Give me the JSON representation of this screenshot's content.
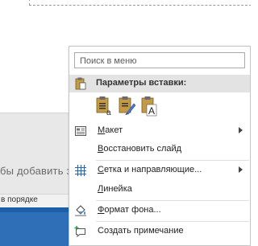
{
  "background": {
    "notes_text": "бы добавить з",
    "status_text": "в порядке"
  },
  "context_menu": {
    "search": {
      "placeholder": "Поиск в меню"
    },
    "paste_header": {
      "label": "Параметры вставки:"
    },
    "paste_options": [
      {
        "name": "keep-source-formatting-icon"
      },
      {
        "name": "use-destination-theme-icon"
      },
      {
        "name": "keep-text-only-icon"
      }
    ],
    "items": [
      {
        "label": "Макет",
        "accel": "М",
        "rest": "акет",
        "has_submenu": true,
        "icon": "layout-icon"
      },
      {
        "label": "Восстановить слайд",
        "accel": "В",
        "rest": "осстановить слайд",
        "has_submenu": false,
        "icon": ""
      },
      {
        "label": "Сетка и направляющие...",
        "accel": "С",
        "rest": "етка и направляющие...",
        "has_submenu": true,
        "icon": "grid-icon"
      },
      {
        "label": "Линейка",
        "accel": "Л",
        "rest": "инейка",
        "has_submenu": false,
        "icon": ""
      },
      {
        "label": "Формат фона...",
        "accel": "Ф",
        "rest": "ормат фона...",
        "has_submenu": false,
        "icon": "format-background-icon"
      },
      {
        "label": "Создать примечание",
        "accel": "",
        "rest": "Создать примечание",
        "has_submenu": false,
        "icon": "new-comment-icon"
      }
    ]
  },
  "colors": {
    "taskbar": "#2e6fb8",
    "menu_header_bg": "#e3e3e3",
    "grid_icon": "#2b5fb3",
    "clipboard": "#b38b3b"
  }
}
